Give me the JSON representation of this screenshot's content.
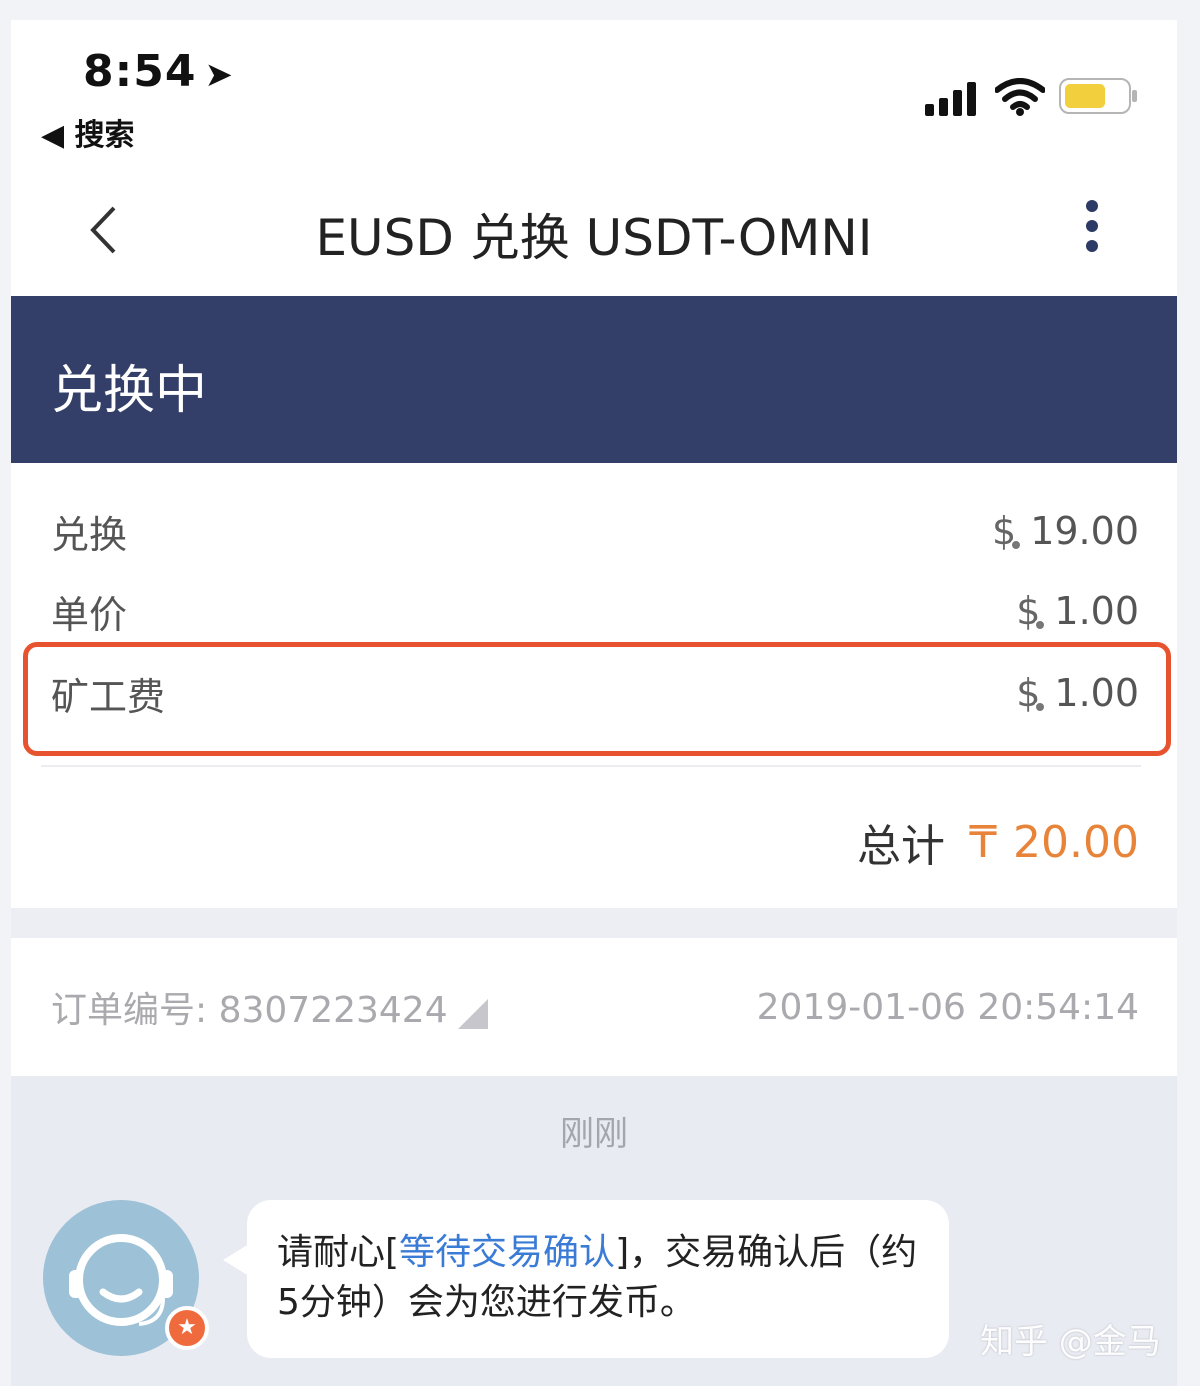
{
  "status_bar": {
    "time": "8:54",
    "location_arrow": "➤",
    "back_app": "◀ 搜索"
  },
  "nav": {
    "title": "EUSD 兑换 USDT-OMNI",
    "back_icon": "chevron-left-icon",
    "more_icon": "more-vertical-icon"
  },
  "banner": {
    "status": "兑换中",
    "color": "#333f68"
  },
  "details": [
    {
      "label": "兑换",
      "currency": "$",
      "value": "19.00"
    },
    {
      "label": "单价",
      "currency": "$",
      "value": "1.00"
    },
    {
      "label": "矿工费",
      "currency": "$",
      "value": "1.00"
    }
  ],
  "total": {
    "label": "总计",
    "currency_icon": "₸",
    "value": "20.00",
    "color": "#e8843a"
  },
  "order": {
    "label": "订单编号: 8307223424",
    "datetime": "2019-01-06 20:54:14"
  },
  "chat": {
    "time": "刚刚",
    "message_before": "请耐心[",
    "message_link": "等待交易确认",
    "message_after": "]，交易确认后（约5分钟）会为您进行发币。",
    "badge_icon": "★"
  },
  "watermark": "知乎 @金马",
  "highlight_color": "#e8532f"
}
